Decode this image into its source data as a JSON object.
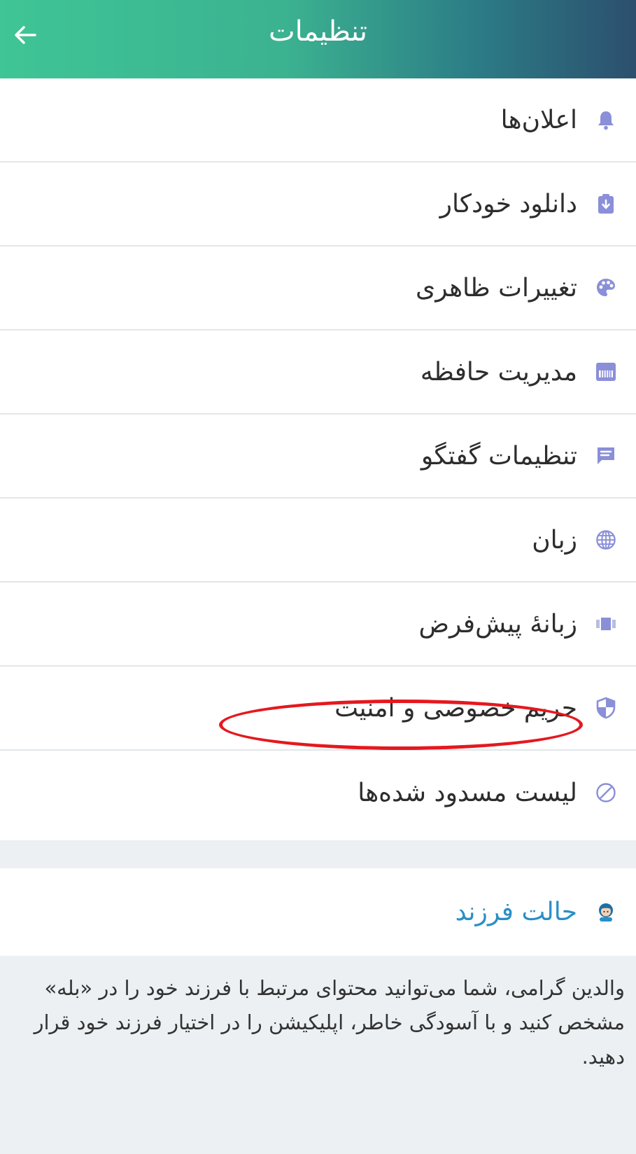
{
  "header": {
    "title": "تنظیمات",
    "back_icon": "arrow-left-icon",
    "gradient_colors": [
      "#3fc596",
      "#2c4f6e"
    ]
  },
  "settings": [
    {
      "id": "notifications",
      "label": "اعلان‌ها",
      "icon": "bell-icon"
    },
    {
      "id": "auto-download",
      "label": "دانلود خودکار",
      "icon": "download-icon"
    },
    {
      "id": "appearance",
      "label": "تغییرات ظاهری",
      "icon": "palette-icon"
    },
    {
      "id": "storage",
      "label": "مدیریت حافظه",
      "icon": "memory-icon"
    },
    {
      "id": "chat-settings",
      "label": "تنظیمات گفتگو",
      "icon": "chat-icon"
    },
    {
      "id": "language",
      "label": "زبان",
      "icon": "globe-icon"
    },
    {
      "id": "default-tab",
      "label": "زبانهٔ پیش‌فرض",
      "icon": "tabs-icon"
    },
    {
      "id": "privacy",
      "label": "حریم خصوصی و امنیت",
      "icon": "shield-icon"
    },
    {
      "id": "block-list",
      "label": "لیست مسدود شده‌ها",
      "icon": "block-icon"
    }
  ],
  "kid_mode": {
    "label": "حالت فرزند",
    "icon": "child-icon",
    "color": "#2a8fc6",
    "description": "والدین گرامی، شما می‌توانید محتوای مرتبط با فرزند خود را در «بله» مشخص کنید و با آسودگی خاطر، اپلیکیشن را در اختیار فرزند خود قرار دهید."
  },
  "colors": {
    "icon": "#8a8fd8",
    "highlight": "#e5181e",
    "panel_background": "#ecf0f3"
  }
}
